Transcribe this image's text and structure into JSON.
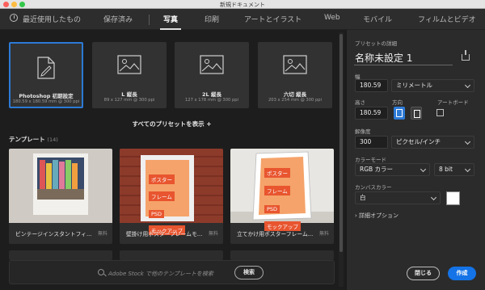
{
  "window": {
    "title": "新規ドキュメント"
  },
  "tabs": [
    {
      "label": "最近使用したもの"
    },
    {
      "label": "保存済み"
    },
    {
      "label": "写真"
    },
    {
      "label": "印刷"
    },
    {
      "label": "アートとイラスト"
    },
    {
      "label": "Web"
    },
    {
      "label": "モバイル"
    },
    {
      "label": "フィルムとビデオ"
    }
  ],
  "active_tab": "写真",
  "presets": [
    {
      "name": "Photoshop 初期設定",
      "dims": "180.59 x 180.59 mm @ 300 ppi",
      "icon": "document-icon"
    },
    {
      "name": "L 縦長",
      "dims": "89 x 127 mm @ 300 ppi",
      "icon": "image-icon"
    },
    {
      "name": "2L 縦長",
      "dims": "127 x 178 mm @ 300 ppi",
      "icon": "image-icon"
    },
    {
      "name": "六切 縦長",
      "dims": "203 x 254 mm @ 300 ppi",
      "icon": "image-icon"
    }
  ],
  "show_all": "すべてのプリセットを表示 +",
  "templates": {
    "title": "テンプレート",
    "count": "(14)",
    "items": [
      {
        "name": "ビンテージインスタントフィ...",
        "price": "無料"
      },
      {
        "name": "壁掛け用ポスターフレームモ...",
        "price": "無料"
      },
      {
        "name": "立てかけ用ポスターフレーム...",
        "price": "無料"
      }
    ],
    "poster_lines": [
      "ポスター",
      "フレーム",
      "PSD",
      "モックアップ"
    ]
  },
  "search": {
    "placeholder": "Adobe Stock で他のテンプレートを検索",
    "button": "検索"
  },
  "panel": {
    "title": "プリセットの詳細",
    "doc_name": "名称未設定 1",
    "width_label": "幅",
    "width_value": "180.59",
    "unit": "ミリメートル",
    "height_label": "高さ",
    "height_value": "180.59",
    "orientation_label": "方向",
    "artboard_label": "アートボード",
    "resolution_label": "解像度",
    "resolution_value": "300",
    "resolution_unit": "ピクセル/インチ",
    "color_mode_label": "カラーモード",
    "color_mode": "RGB カラー",
    "bit_depth": "8 bit",
    "canvas_color_label": "カンバスカラー",
    "canvas_color": "白",
    "advanced": "詳細オプション",
    "close_button": "閉じる",
    "create_button": "作成"
  },
  "colors": {
    "accent": "#1473e6",
    "selected_border": "#2d7ad6"
  }
}
